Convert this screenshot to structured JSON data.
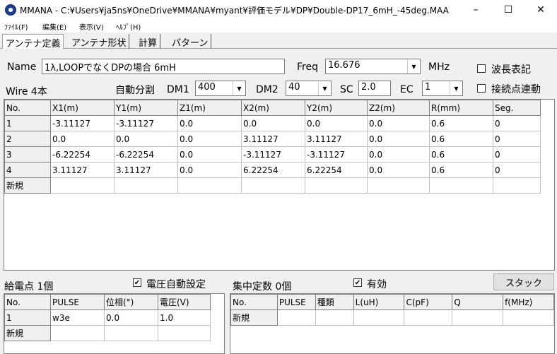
{
  "window": {
    "title": "MMANA - C:¥Users¥ja5ns¥OneDrive¥MMANA¥myant¥評価モデル¥DP¥Double-DP17_6mH_-45deg.MAA",
    "minimize": "–",
    "maximize": "☐",
    "close": "✕"
  },
  "menu": [
    "ﾌｧｲﾙ(F)",
    "編集(E)",
    "表示(V)",
    "ﾍﾙﾌﾟ(H)"
  ],
  "tabs": [
    "アンテナ定義",
    "アンテナ形状",
    "計算",
    "パターン"
  ],
  "form": {
    "name_label": "Name",
    "name_value": "1λ,LOOPでなくDPの場合  6mH",
    "freq_label": "Freq",
    "freq_value": "16.676",
    "freq_unit": "MHz",
    "wavelength_label": "波長表記",
    "wire_count_label": "Wire 4本",
    "auto_seg_label": "自動分割",
    "dm1_label": "DM1",
    "dm1_value": "400",
    "dm2_label": "DM2",
    "dm2_value": "40",
    "sc_label": "SC",
    "sc_value": "2.0",
    "ec_label": "EC",
    "ec_value": "1",
    "junction_label": "接続点連動"
  },
  "wires": {
    "headers": [
      "No.",
      "X1(m)",
      "Y1(m)",
      "Z1(m)",
      "X2(m)",
      "Y2(m)",
      "Z2(m)",
      "R(mm)",
      "Seg."
    ],
    "rows": [
      [
        "1",
        "-3.11127",
        "-3.11127",
        "0.0",
        "0.0",
        "0.0",
        "0.0",
        "0.6",
        "0"
      ],
      [
        "2",
        "0.0",
        "0.0",
        "0.0",
        "3.11127",
        "3.11127",
        "0.0",
        "0.6",
        "0"
      ],
      [
        "3",
        "-6.22254",
        "-6.22254",
        "0.0",
        "-3.11127",
        "-3.11127",
        "0.0",
        "0.6",
        "0"
      ],
      [
        "4",
        "3.11127",
        "3.11127",
        "0.0",
        "6.22254",
        "6.22254",
        "0.0",
        "0.6",
        "0"
      ]
    ],
    "new_row": "新規"
  },
  "feed": {
    "title": "給電点 1個",
    "auto_voltage_label": "電圧自動設定",
    "auto_voltage_checked": true,
    "headers": [
      "No.",
      "PULSE",
      "位相(°)",
      "電圧(V)"
    ],
    "rows": [
      [
        "1",
        "w3e",
        "0.0",
        "1.0"
      ]
    ],
    "new_row": "新規"
  },
  "loads": {
    "title": "集中定数 0個",
    "enabled_label": "有効",
    "enabled_checked": true,
    "stack_button": "スタック",
    "headers": [
      "No.",
      "PULSE",
      "種類",
      "L(uH)",
      "C(pF)",
      "Q",
      "f(MHz)"
    ],
    "new_row": "新規"
  }
}
